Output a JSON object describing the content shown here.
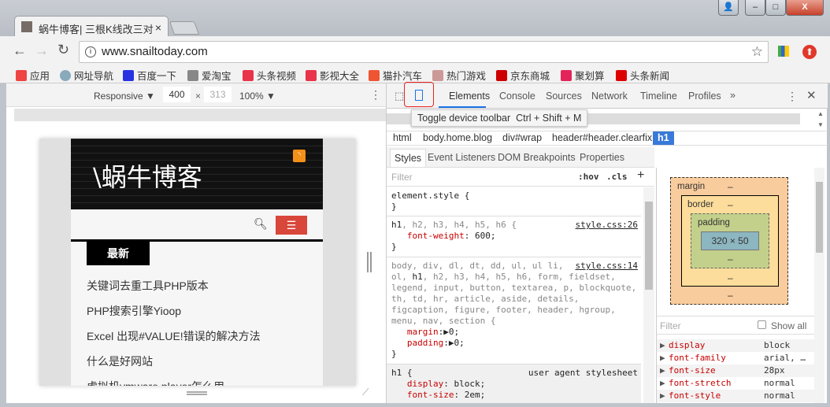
{
  "window": {
    "minimize": "–",
    "maximize": "□",
    "close": "X"
  },
  "tab": {
    "title": "蜗牛博客| 三根K线改三对",
    "close": "×"
  },
  "address": {
    "url": "www.snailtoday.com"
  },
  "bookmarks": [
    {
      "label": "应用",
      "icon": "apps-grid-icon",
      "color": "#e44"
    },
    {
      "label": "网址导航",
      "icon": "globe-icon",
      "color": "#8ab"
    },
    {
      "label": "百度一下",
      "icon": "baidu-paw-icon",
      "color": "#2932e1"
    },
    {
      "label": "爱淘宝",
      "icon": "page-icon",
      "color": "#888"
    },
    {
      "label": "头条视频",
      "icon": "play-icon",
      "color": "#e8334a"
    },
    {
      "label": "影视大全",
      "icon": "play-outline-icon",
      "color": "#e8334a"
    },
    {
      "label": "猫扑汽车",
      "icon": "mop-icon",
      "color": "#e53"
    },
    {
      "label": "热门游戏",
      "icon": "avatar-icon",
      "color": "#c99"
    },
    {
      "label": "京东商城",
      "icon": "jd-icon",
      "color": "#c00"
    },
    {
      "label": "聚划算",
      "icon": "ju-icon",
      "color": "#e2245a"
    },
    {
      "label": "头条新闻",
      "icon": "toutiao-icon",
      "color": "#d00"
    }
  ],
  "device_toolbar": {
    "mode": "Responsive ▼",
    "width": "400",
    "x": "×",
    "height": "313",
    "zoom": "100% ▼"
  },
  "site": {
    "logo": "\\蜗牛博客",
    "section": "最新",
    "articles": [
      "关键词去重工具PHP版本",
      "PHP搜索引擎Yioop",
      "Excel 出现#VALUE!错误的解决方法",
      "什么是好网站",
      "虚拟机vmware player怎么用"
    ],
    "menu_color": "#d9463a"
  },
  "devtools": {
    "tabs": [
      "Elements",
      "Console",
      "Sources",
      "Network",
      "Timeline",
      "Profiles"
    ],
    "more": "»",
    "tooltip": "Toggle device toolbar  Ctrl + Shift + M",
    "breadcrumbs": [
      "html",
      "body.home.blog",
      "div#wrap",
      "header#header.clearfix",
      "h1"
    ],
    "style_tabs": [
      "Styles",
      "Event Listeners",
      "DOM Breakpoints",
      "Properties"
    ],
    "filter_placeholder": "Filter",
    "hov": ":hov",
    "cls": ".cls",
    "add": "+",
    "rules": [
      {
        "selector": "element.style {",
        "close": "}"
      },
      {
        "selector_active": "h1",
        "selector_rest": ", h2, h3, h4, h5, h6 {",
        "source": "style.css:26",
        "props": [
          {
            "name": "font-weight",
            "value": "600;"
          }
        ],
        "close": "}"
      },
      {
        "selector_a": "body, div, dl, dt, dd, ul, ul li,",
        "selector_b1": "ol, ",
        "selector_b_active": "h1",
        "selector_b2": ", h2, h3, h4, h5, h6, form, fieldset,",
        "selector_c": "legend, input, button, textarea, p, blockquote,",
        "selector_d": "th, td, hr, article, aside, details,",
        "selector_e": "figcaption, figure, footer, header, hgroup,",
        "selector_f": "menu, nav, section {",
        "source": "style.css:14",
        "props": [
          {
            "name": "margin",
            "value": "▶0;"
          },
          {
            "name": "padding",
            "value": "▶0;"
          }
        ],
        "close": "}"
      },
      {
        "selector": "h1 {",
        "source": "user agent stylesheet",
        "props": [
          {
            "name": "display",
            "value": "block;"
          },
          {
            "name": "font-size",
            "value": "2em;"
          }
        ]
      }
    ],
    "box_model": {
      "margin": "margin",
      "border": "border",
      "padding": "padding",
      "content": "320 × 50",
      "dash": "–"
    },
    "computed_filter": "Filter",
    "show_all": "Show all",
    "computed": [
      {
        "name": "display",
        "value": "block"
      },
      {
        "name": "font-family",
        "value": "arial, …"
      },
      {
        "name": "font-size",
        "value": "28px"
      },
      {
        "name": "font-stretch",
        "value": "normal"
      },
      {
        "name": "font-style",
        "value": "normal"
      }
    ]
  }
}
